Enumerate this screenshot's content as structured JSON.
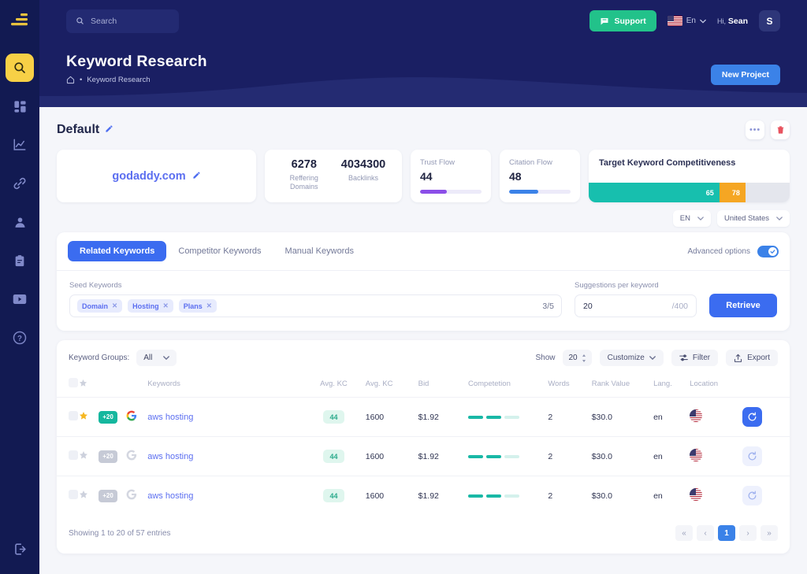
{
  "sidebar": {
    "logo": "logo-bars",
    "items": [
      {
        "name": "search",
        "icon": "search-icon",
        "active": true
      },
      {
        "name": "dashboard",
        "icon": "grid-dashboard-icon",
        "active": false
      },
      {
        "name": "analytics",
        "icon": "line-chart-icon",
        "active": false
      },
      {
        "name": "backlinks",
        "icon": "link-chain-icon",
        "active": false
      },
      {
        "name": "account",
        "icon": "user-icon",
        "active": false
      },
      {
        "name": "reports",
        "icon": "clipboard-icon",
        "active": false
      },
      {
        "name": "tutorials",
        "icon": "video-play-icon",
        "active": false
      },
      {
        "name": "help",
        "icon": "question-circle-icon",
        "active": false
      }
    ],
    "logout_icon": "logout-icon"
  },
  "topbar": {
    "search_placeholder": "Search",
    "search_icon": "search-icon",
    "support_label": "Support",
    "support_icon": "support-chat-icon",
    "support_color": "#22c28a",
    "flag": "us-flag-icon",
    "language": "En",
    "greeting_prefix": "Hi,",
    "greeting_name": "Sean",
    "avatar_initial": "S"
  },
  "pagehead": {
    "title": "Keyword Research",
    "home_icon": "home-icon",
    "breadcrumb_sep": "•",
    "breadcrumb": "Keyword Research",
    "new_project_label": "New Project",
    "new_project_color": "#3b82e8"
  },
  "project": {
    "name": "Default",
    "edit_icon": "pencil-icon",
    "more_icon": "more-dots-icon",
    "delete_icon": "trash-icon",
    "delete_color": "#e8535f"
  },
  "cards": {
    "domain": {
      "value": "godaddy.com",
      "edit_icon": "pencil-icon",
      "color": "#5b6ef0"
    },
    "backlinks": [
      {
        "value": "6278",
        "label": "Reffering Domains"
      },
      {
        "value": "4034300",
        "label": "Backlinks"
      }
    ],
    "trust_flow": {
      "label": "Trust Flow",
      "value": "44",
      "percent": 44,
      "color": "#8b4ee8"
    },
    "citation_flow": {
      "label": "Citation Flow",
      "value": "48",
      "percent": 48,
      "color": "#3b82e8"
    },
    "competitiveness": {
      "title": "Target Keyword Competitiveness",
      "segments": [
        {
          "value": "65",
          "percent": 65,
          "color": "#17bfae"
        },
        {
          "value": "78",
          "percent": 13,
          "color": "#f5a623"
        }
      ],
      "track_color": "#e4e6ed"
    }
  },
  "locale": {
    "language": "EN",
    "country": "United States",
    "chevron_icon": "chevron-down-icon"
  },
  "tabs": {
    "items": [
      {
        "label": "Related Keywords",
        "active": true
      },
      {
        "label": "Competitor Keywords",
        "active": false
      },
      {
        "label": "Manual Keywords",
        "active": false
      }
    ],
    "advanced_label": "Advanced options",
    "advanced_on": true
  },
  "seed": {
    "label": "Seed Keywords",
    "chips": [
      "Domain",
      "Hosting",
      "Plans"
    ],
    "count": "3/5",
    "suggestions_label": "Suggestions per keyword",
    "suggestions_value": "20",
    "suggestions_max": "/400",
    "retrieve_label": "Retrieve"
  },
  "table_controls": {
    "keyword_groups_label": "Keyword Groups:",
    "keyword_groups_value": "All",
    "show_label": "Show",
    "show_value": "20",
    "customize_label": "Customize",
    "filter_label": "Filter",
    "filter_icon": "filter-icon",
    "export_label": "Export",
    "export_icon": "export-upload-icon"
  },
  "table": {
    "headers": [
      "",
      "",
      "",
      "",
      "Keywords",
      "Avg. KC",
      "Avg. KC",
      "Bid",
      "Competetion",
      "Words",
      "Rank Value",
      "Lang.",
      "Location",
      ""
    ],
    "star_icon": "star-icon",
    "google_icon": "google-g-icon",
    "refresh_icon": "refresh-icon",
    "rows": [
      {
        "starred": true,
        "badge": "+20",
        "badge_on": true,
        "google_on": true,
        "keyword": "aws hosting",
        "kc": "44",
        "volume": "1600",
        "bid": "$1.92",
        "competition_filled": 2,
        "competition_total": 3,
        "words": "2",
        "rank_value": "$30.0",
        "lang": "en",
        "location": "us-flag-icon",
        "action_on": true
      },
      {
        "starred": false,
        "badge": "+20",
        "badge_on": false,
        "google_on": false,
        "keyword": "aws hosting",
        "kc": "44",
        "volume": "1600",
        "bid": "$1.92",
        "competition_filled": 2,
        "competition_total": 3,
        "words": "2",
        "rank_value": "$30.0",
        "lang": "en",
        "location": "us-flag-icon",
        "action_on": false
      },
      {
        "starred": false,
        "badge": "+20",
        "badge_on": false,
        "google_on": false,
        "keyword": "aws hosting",
        "kc": "44",
        "volume": "1600",
        "bid": "$1.92",
        "competition_filled": 2,
        "competition_total": 3,
        "words": "2",
        "rank_value": "$30.0",
        "lang": "en",
        "location": "us-flag-icon",
        "action_on": false
      }
    ]
  },
  "footer": {
    "showing": "Showing 1 to 20 of 57 entries",
    "pages": [
      {
        "label": "«",
        "current": false
      },
      {
        "label": "‹",
        "current": false
      },
      {
        "label": "1",
        "current": true
      },
      {
        "label": "›",
        "current": false
      },
      {
        "label": "»",
        "current": false
      }
    ]
  }
}
